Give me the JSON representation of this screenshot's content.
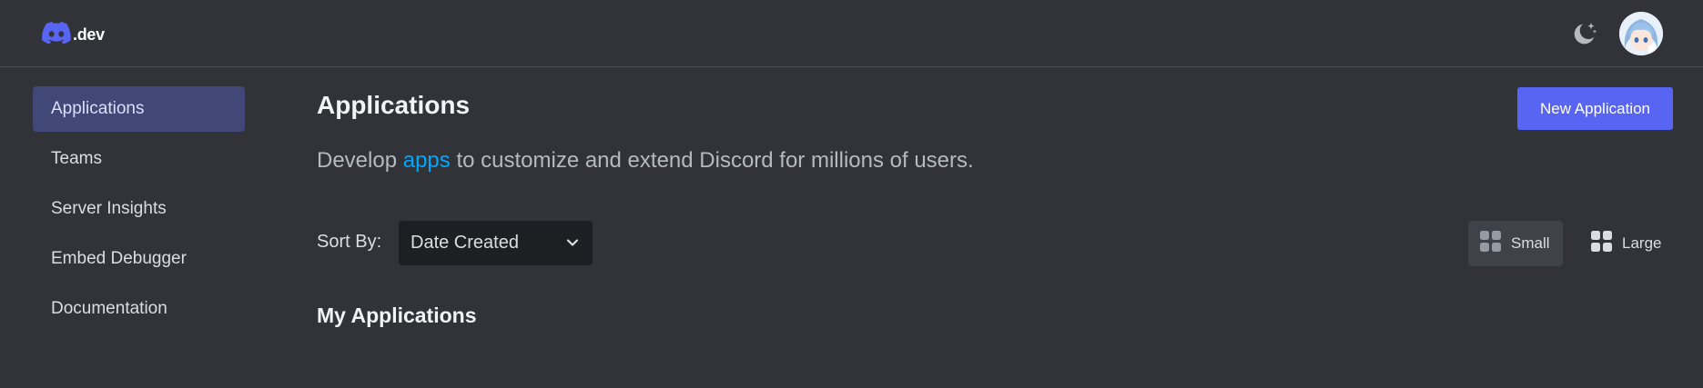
{
  "header": {
    "logo_text": ".dev",
    "logo_icon": "discord-icon",
    "theme_icon": "moon-stars-icon",
    "avatar_alt": "user-avatar"
  },
  "sidebar": {
    "items": [
      {
        "label": "Applications",
        "active": true
      },
      {
        "label": "Teams",
        "active": false
      },
      {
        "label": "Server Insights",
        "active": false
      },
      {
        "label": "Embed Debugger",
        "active": false
      },
      {
        "label": "Documentation",
        "active": false
      }
    ]
  },
  "main": {
    "title": "Applications",
    "new_button_label": "New Application",
    "description_before": "Develop ",
    "description_link": "apps",
    "description_after": " to customize and extend Discord for millions of users.",
    "sort": {
      "label": "Sort By:",
      "selected": "Date Created"
    },
    "view": {
      "small_label": "Small",
      "large_label": "Large",
      "selected": "Small"
    },
    "section_title": "My Applications"
  },
  "colors": {
    "background": "#313338",
    "accent": "#5865f2",
    "active_nav": "#414777",
    "link": "#00a8fc",
    "select_bg": "#1e1f22"
  }
}
